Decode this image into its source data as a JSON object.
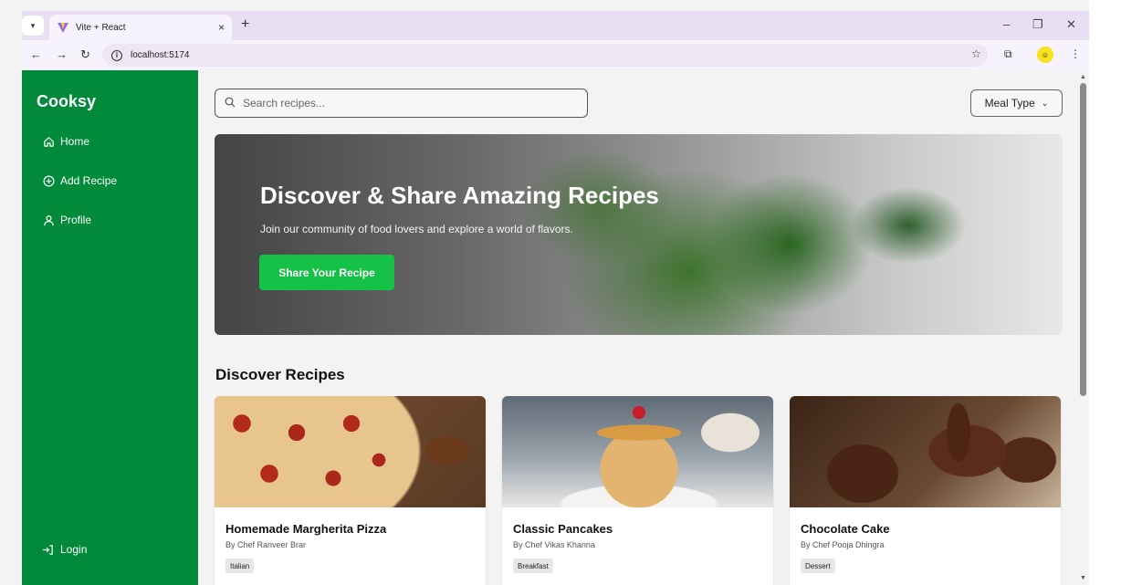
{
  "browser": {
    "tab_title": "Vite + React",
    "tab_close": "×",
    "new_tab": "+",
    "url": "localhost:5174",
    "controls": {
      "minimize": "–",
      "restore": "❐",
      "close": "✕"
    }
  },
  "sidebar": {
    "brand": "Cooksy",
    "items": [
      {
        "label": "Home",
        "icon": "home-icon"
      },
      {
        "label": "Add Recipe",
        "icon": "plus-circle-icon"
      },
      {
        "label": "Profile",
        "icon": "user-icon"
      }
    ],
    "login": {
      "label": "Login",
      "icon": "login-icon"
    },
    "bg_color": "#008a3a"
  },
  "main": {
    "search": {
      "placeholder": "Search recipes..."
    },
    "meal_type_label": "Meal Type",
    "hero": {
      "title": "Discover & Share Amazing Recipes",
      "subtitle": "Join our community of food lovers and explore a world of flavors.",
      "cta": "Share Your Recipe",
      "cta_color": "#16c148"
    },
    "section_title": "Discover Recipes",
    "recipes": [
      {
        "name": "Homemade Margherita Pizza",
        "chef": "By Chef Ranveer Brar",
        "tag": "Italian"
      },
      {
        "name": "Classic Pancakes",
        "chef": "By Chef Vikas Khanna",
        "tag": "Breakfast"
      },
      {
        "name": "Chocolate Cake",
        "chef": "By Chef Pooja Dhingra",
        "tag": "Dessert"
      }
    ]
  }
}
